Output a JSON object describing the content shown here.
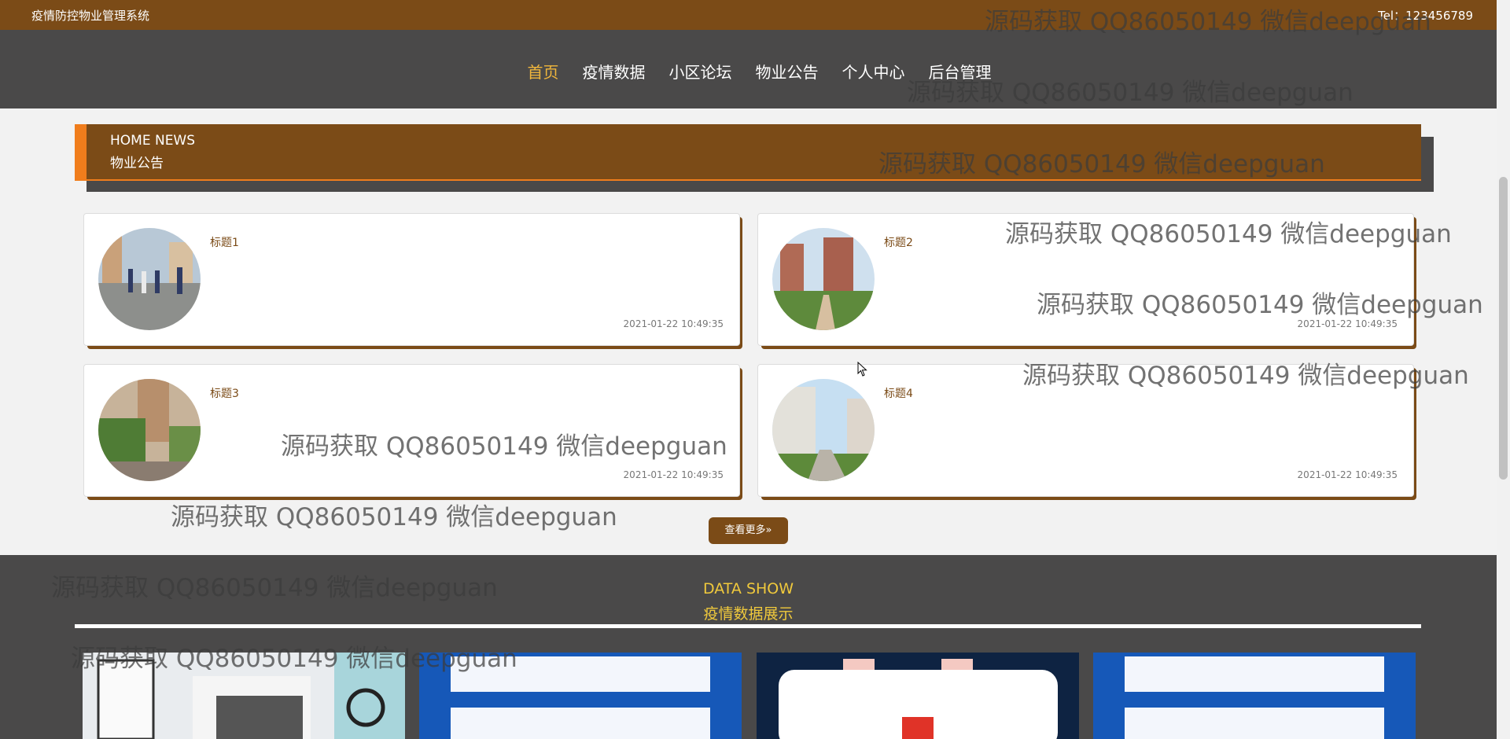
{
  "topbar": {
    "site_title": "疫情防控物业管理系统",
    "tel": "Tel：123456789"
  },
  "nav": {
    "items": [
      "首页",
      "疫情数据",
      "小区论坛",
      "物业公告",
      "个人中心",
      "后台管理"
    ]
  },
  "section": {
    "title_en": "HOME NEWS",
    "title_cn": "物业公告"
  },
  "news": [
    {
      "title": "标题1",
      "date": "2021-01-22 10:49:35"
    },
    {
      "title": "标题2",
      "date": "2021-01-22 10:49:35"
    },
    {
      "title": "标题3",
      "date": "2021-01-22 10:49:35"
    },
    {
      "title": "标题4",
      "date": "2021-01-22 10:49:35"
    }
  ],
  "more_button": "查看更多»",
  "data_show": {
    "title_en": "DATA SHOW",
    "title_cn": "疫情数据展示"
  },
  "watermark": "源码获取 QQ86050149 微信deepguan",
  "colors": {
    "brown": "#7b4b17",
    "orange": "#f07d1c",
    "gold": "#f0b63c",
    "dark": "#4a4949"
  }
}
